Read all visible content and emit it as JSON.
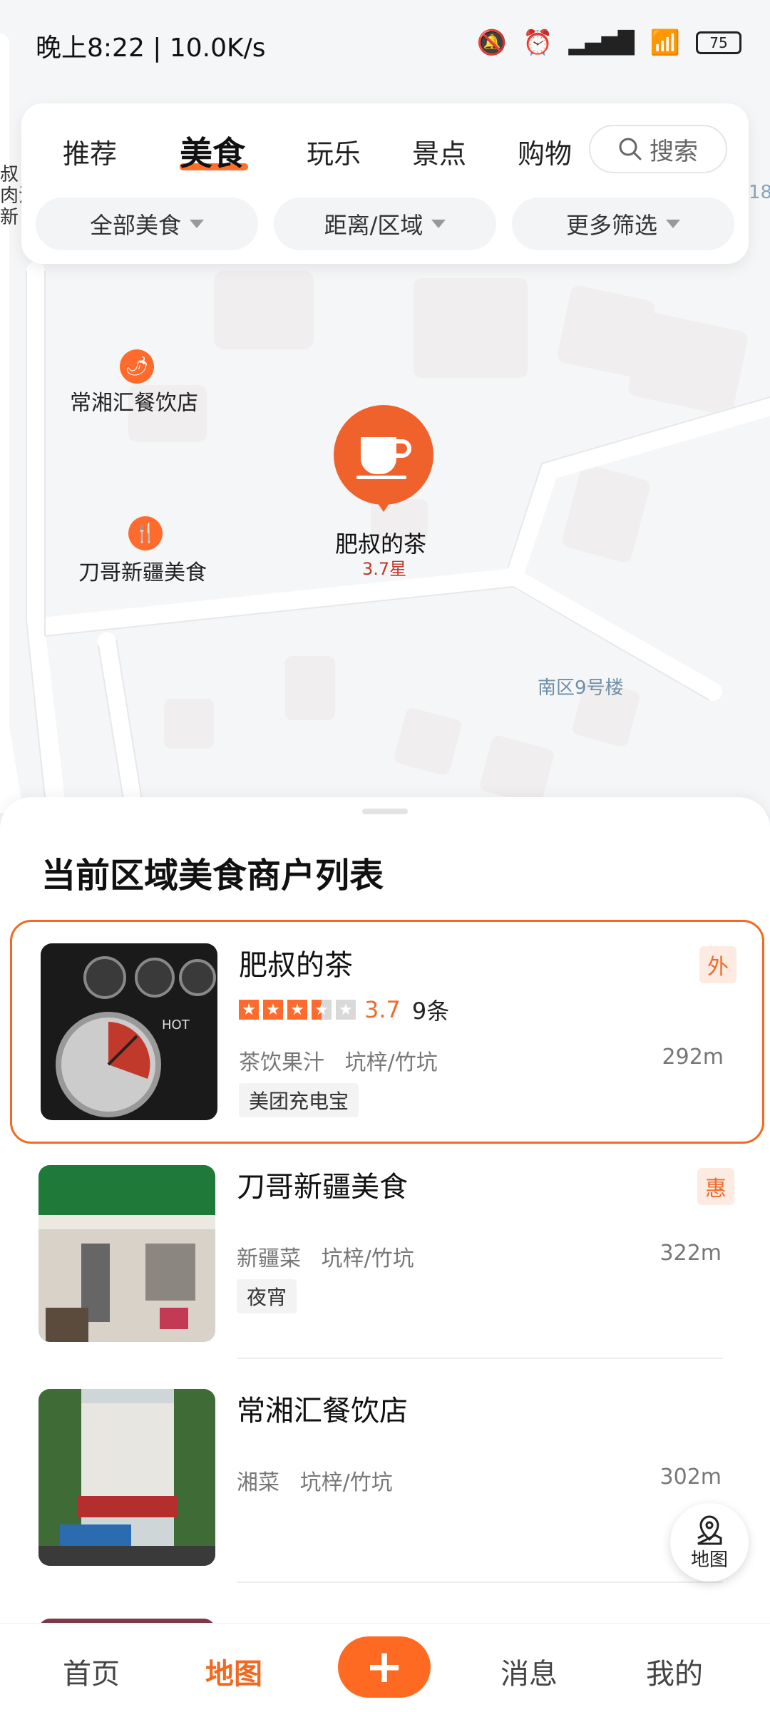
{
  "status_bar": {
    "time": "晚上8:22 | 10.0K/s",
    "battery": "75"
  },
  "tabs": [
    "推荐",
    "美食",
    "玩乐",
    "景点",
    "购物"
  ],
  "search": {
    "label": "搜索"
  },
  "filters": [
    "全部美食",
    "距离/区域",
    "更多筛选"
  ],
  "map": {
    "pois": [
      {
        "name": "常湘汇餐饮店",
        "icon": "chili-icon"
      },
      {
        "name": "刀哥新疆美食",
        "icon": "fork-knife-icon"
      }
    ],
    "selected": {
      "name": "肥叔的茶",
      "rating": "3.7星",
      "icon": "tea-cup-icon"
    },
    "building_label": "南区9号楼"
  },
  "sheet": {
    "title": "当前区域美食商户列表"
  },
  "shops": [
    {
      "name": "肥叔的茶",
      "badge": "外",
      "score": "3.7",
      "reviews": "9条",
      "category": "茶饮果汁",
      "area": "坑梓/竹坑",
      "distance": "292m",
      "tag": "美团充电宝"
    },
    {
      "name": "刀哥新疆美食",
      "badge": "惠",
      "category": "新疆菜",
      "area": "坑梓/竹坑",
      "distance": "322m",
      "tag": "夜宵"
    },
    {
      "name": "常湘汇餐饮店",
      "category": "湘菜",
      "area": "坑梓/竹坑",
      "distance": "302m"
    }
  ],
  "map_fab": {
    "label": "地图"
  },
  "bottom_nav": {
    "home": "首页",
    "map": "地图",
    "plus": "+",
    "messages": "消息",
    "mine": "我的"
  },
  "colors": {
    "accent": "#f3681f",
    "map_bg": "#f5f6f7"
  }
}
